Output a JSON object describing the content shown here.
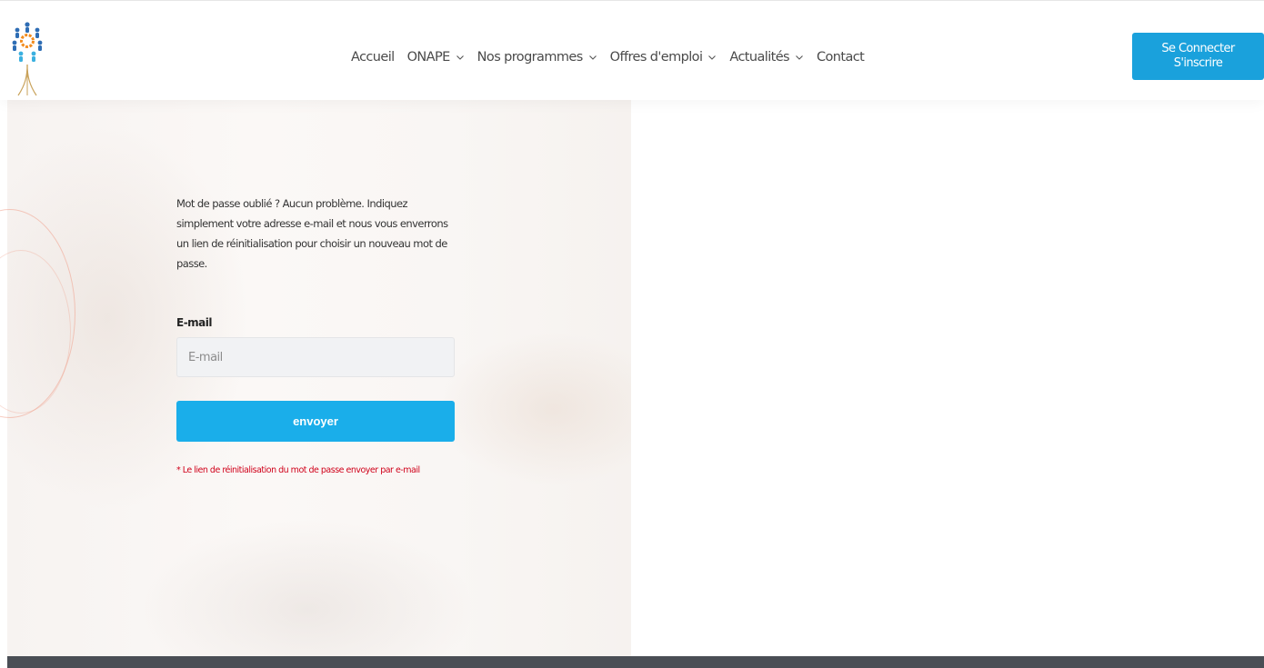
{
  "header": {
    "nav": [
      {
        "label": "Accueil",
        "has_dropdown": false
      },
      {
        "label": "ONAPE",
        "has_dropdown": true
      },
      {
        "label": "Nos programmes",
        "has_dropdown": true
      },
      {
        "label": "Offres d'emploi",
        "has_dropdown": true
      },
      {
        "label": "Actualités",
        "has_dropdown": true
      },
      {
        "label": "Contact",
        "has_dropdown": false
      }
    ],
    "cta": {
      "line1": "Se Connecter",
      "line2": "S'inscrire"
    }
  },
  "form": {
    "intro": "Mot de passe oublié ? Aucun problème. Indiquez simplement votre adresse e-mail et nous vous enverrons un lien de réinitialisation pour choisir un nouveau mot de passe.",
    "email_label": "E-mail",
    "email_placeholder": "E-mail",
    "email_value": "",
    "submit_label": "envoyer",
    "note": "* Le lien de réinitialisation du mot de passe envoyer par e-mail"
  },
  "colors": {
    "accent": "#1aaeea",
    "cta": "#1aa1dc",
    "error": "#d0021b",
    "footer": "#4a4e55"
  },
  "icons": {
    "logo": "onape-tree-logo",
    "dropdown": "chevron-down-icon"
  }
}
